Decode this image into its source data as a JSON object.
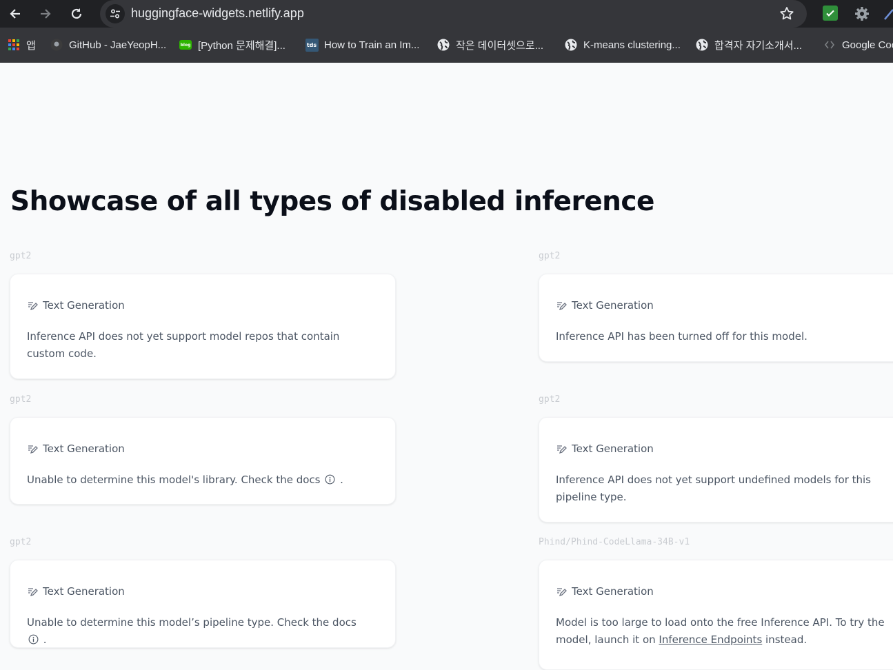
{
  "browser": {
    "url": "huggingface-widgets.netlify.app",
    "bookmarks": [
      {
        "label": "앱",
        "icon": "apps-grid-icon"
      },
      {
        "label": "GitHub - JaeYeopH...",
        "icon": "github-icon"
      },
      {
        "label": "[Python 문제해결]...",
        "icon": "naver-blog-icon"
      },
      {
        "label": "How to Train an Im...",
        "icon": "tds-icon"
      },
      {
        "label": "작은 데이터셋으로...",
        "icon": "globe-icon"
      },
      {
        "label": "K-means clustering...",
        "icon": "globe-icon"
      },
      {
        "label": "합격자 자기소개서...",
        "icon": "globe-icon"
      },
      {
        "label": "Google Coc",
        "icon": "code-icon"
      }
    ],
    "blog_badge": "blog",
    "tds_badge": "tds"
  },
  "page": {
    "title": "Showcase of all types of disabled inference",
    "cards": [
      {
        "model": "gpt2",
        "task": "Text Generation",
        "message": "Inference API does not yet support model repos that contain custom code."
      },
      {
        "model": "gpt2",
        "task": "Text Generation",
        "message": "Inference API has been turned off for this model."
      },
      {
        "model": "gpt2",
        "task": "Text Generation",
        "message_before": "Unable to determine this model's library. Check the docs",
        "message_after": "."
      },
      {
        "model": "gpt2",
        "task": "Text Generation",
        "message": "Inference API does not yet support undefined models for this pipeline type."
      },
      {
        "model": "gpt2",
        "task": "Text Generation",
        "message_before": "Unable to determine this model’s pipeline type. Check the docs",
        "message_after": "."
      },
      {
        "model": "Phind/Phind-CodeLlama-34B-v1",
        "task": "Text Generation",
        "message_before": "Model is too large to load onto the free Inference API. To try the model, launch it on",
        "link": "Inference Endpoints",
        "message_after": "instead."
      }
    ]
  },
  "colors": {
    "chrome_bg": "#202124",
    "bookmark_bar": "#35363a",
    "page_bg": "#f9fafb",
    "card_bg": "#ffffff",
    "text_gray": "#4b5563",
    "label_gray": "#c9ccd1"
  }
}
